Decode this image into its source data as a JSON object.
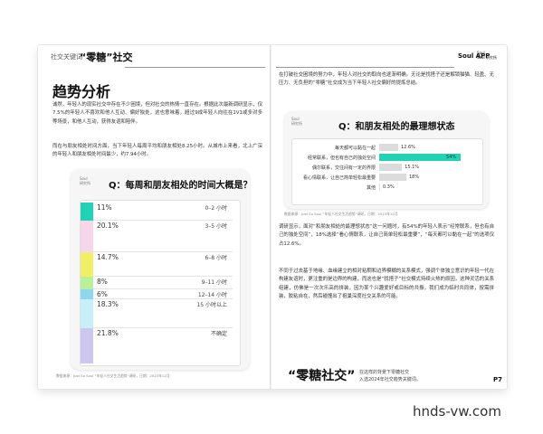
{
  "header": {
    "left_label": "社交关键词",
    "title": "“零糖”社交",
    "right_brand": "Soul APP",
    "right_logo_line1": "Soul",
    "right_logo_line2": "Soul 研究所"
  },
  "left": {
    "section_title": "趋势分析",
    "paragraph_1": "诚然，年轻人的现实社交中存在不少困境，但对社交的热情一直存在。根据此次最新调研显示，仅7.5%的年轻人不喜欢和他人互动、偏好独处，这也意味着，超过9成年轻人向往在1V1或多对多等场景，和他人互动，获得友谊和陪伴。",
    "paragraph_2": "而在与朋友相处时间方面，当下年轻人每周平均和朋友相处8.25小时。从城市上来看，北上广深的年轻人和朋友相处时间最少，约7.94小时。",
    "card_logo_line1": "Soul",
    "card_logo_line2": "研究所",
    "card_question": "Q：每周和朋友相处的时间大概是？",
    "source": "数据来源：Just So Soul “年轻人社交生活趋势”调研，日期：2023年12月"
  },
  "right": {
    "paragraph_1": "在打破社交困境的努力中，年轻人对社交的取向也逐渐明确。无论是找搭子还是解锁猫猫、轻盈、无压力、无负担的“零糖”社交成为当下年轻人社交偏好的提炼总结。",
    "card_logo_line1": "Soul",
    "card_logo_line2": "研究所",
    "card_question": "Q：和朋友相处的最理想状态",
    "source": "数据来源：Just So Soul “年轻人社交生活趋势”调研，日期：2023年12月",
    "paragraph_2": "调研显示，面对“和朋友相处的最理想状态”这一问题时，有54%的年轻人表示“经常联系，但也有自己的独处空间”，18%选择“看心情联系，让自己简单轻松最重要”，“每天都可以黏在一起”的选项仅占12.6%。",
    "paragraph_3": "不同于过去基于地缘、血缘建立的相对粘稠和边界模糊的关系模式，强调个体独立意识的年轻一代在构建友谊时，更注重的是边界的构建，而这也是“找搭子”社交模式持续火热的原因，这种灵活的关系组建，仿佛是一次次乐高的拼装，因为某个兴趣爱好或目标的共振，我们成为临时共同体，按需拼装，胶粘自在，然后碰撞出了祖巢深度社交关系的可能。"
  },
  "footer": {
    "brand": "“零糖社交”",
    "tagline_1": "在这样的背景下零糖社交",
    "tagline_2": "入选2024年社交趋势关键词。",
    "page_number": "P7"
  },
  "watermark": "hnds-vw.com",
  "colors": {
    "teal": "#21d2b4",
    "yellow": "#f0ef66",
    "pink": "#f5d6ea",
    "green": "#baef9b",
    "blue": "#8fd7ef",
    "lightblue": "#c8eef9",
    "lavender": "#cdc7ef",
    "grey_bar": "#dcdcdc"
  },
  "chart_data": [
    {
      "type": "bar",
      "orientation": "vertical-stack",
      "title": "Q：每周和朋友相处的时间大概是？",
      "categories": [
        "0–2 小时",
        "3–5 小时",
        "6–8 小时",
        "9–11 小时",
        "12–14 小时",
        "15 小时以上",
        "不确定"
      ],
      "values": [
        11,
        20.1,
        14.7,
        8,
        6,
        18.3,
        21.8
      ],
      "labels": [
        "11%",
        "20.1%",
        "14.7%",
        "8%",
        "6%",
        "18.3%",
        "21.8%"
      ],
      "colors": [
        "#21d2b4",
        "#f5d6ea",
        "#f0ef66",
        "#baef9b",
        "#8fd7ef",
        "#c8eef9",
        "#cdc7ef"
      ]
    },
    {
      "type": "bar",
      "orientation": "horizontal",
      "title": "Q：和朋友相处的最理想状态",
      "categories": [
        "每天都可以黏在一起",
        "经常联系，但也有自己的独处空间",
        "偶尔联系，交往间有一定的界限",
        "看心情联系，让自己简单轻松最重要",
        "其他"
      ],
      "values": [
        12.6,
        54,
        15.1,
        18,
        0.3
      ],
      "labels": [
        "12.6%",
        "54%",
        "15.1%",
        "18%",
        "0.3%"
      ],
      "colors": [
        "#dcdcdc",
        "#21d2b4",
        "#dcdcdc",
        "#dcdcdc",
        "#dcdcdc"
      ],
      "xlim": [
        0,
        60
      ]
    }
  ]
}
